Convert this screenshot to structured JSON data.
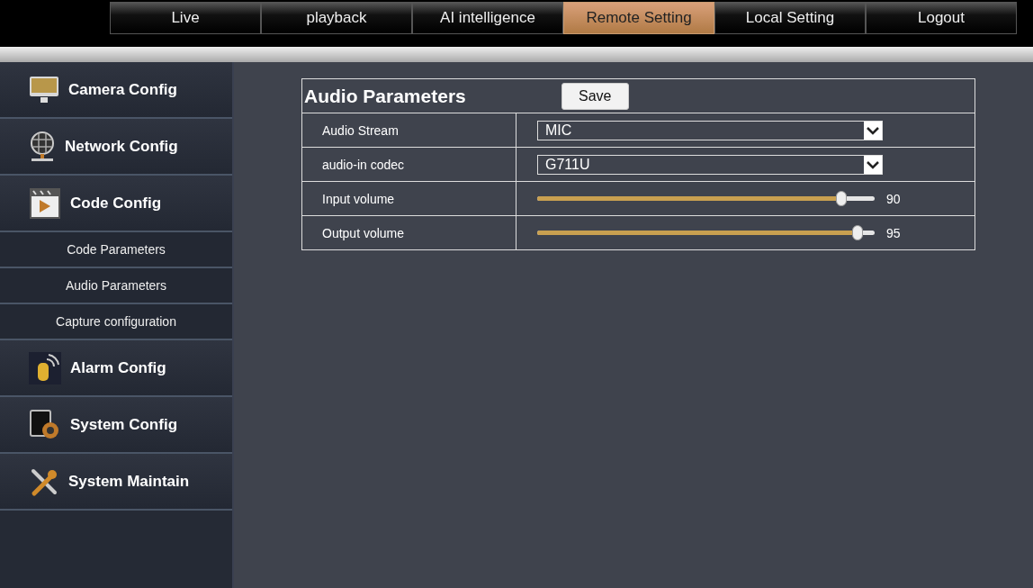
{
  "tabs": [
    {
      "label": "Live",
      "selected": false
    },
    {
      "label": "playback",
      "selected": false
    },
    {
      "label": "AI intelligence",
      "selected": false
    },
    {
      "label": "Remote Setting",
      "selected": true
    },
    {
      "label": "Local Setting",
      "selected": false
    },
    {
      "label": "Logout",
      "selected": false
    }
  ],
  "sidebar": {
    "items": [
      {
        "kind": "monitor",
        "label": "Camera Config"
      },
      {
        "kind": "globe",
        "label": "Network Config"
      },
      {
        "kind": "clapper",
        "label": "Code Config",
        "children": [
          {
            "label": "Code Parameters"
          },
          {
            "label": "Audio Parameters"
          },
          {
            "label": "Capture configuration"
          }
        ]
      },
      {
        "kind": "alarm",
        "label": "Alarm Config"
      },
      {
        "kind": "gear",
        "label": "System Config"
      },
      {
        "kind": "tools",
        "label": "System Maintain"
      }
    ]
  },
  "panel": {
    "title": "Audio Parameters",
    "save_button": "Save",
    "rows": [
      {
        "kind": "select",
        "label": "Audio Stream",
        "value": "MIC"
      },
      {
        "kind": "select",
        "label": "audio-in codec",
        "value": "G711U"
      },
      {
        "kind": "slider",
        "label": "Input volume",
        "level": 0.9,
        "reading": "90"
      },
      {
        "kind": "slider",
        "label": "Output volume",
        "level": 0.95,
        "reading": "95"
      }
    ]
  }
}
